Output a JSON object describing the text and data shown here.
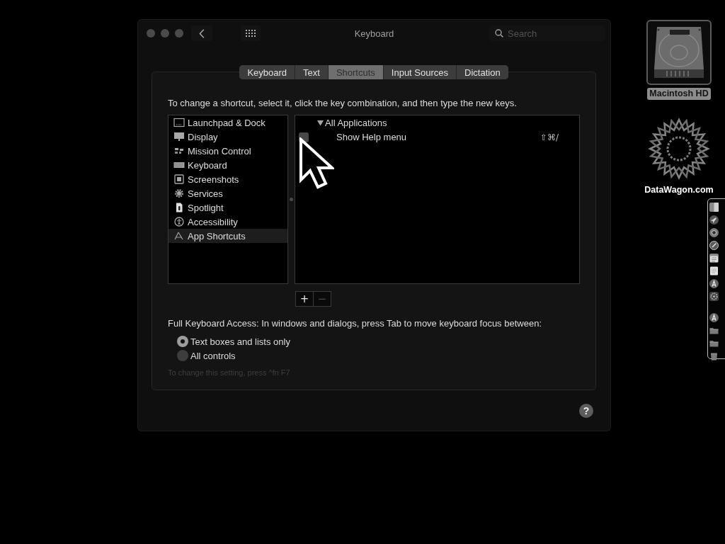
{
  "window": {
    "title": "Keyboard",
    "search": {
      "placeholder": "Search"
    }
  },
  "tabs": [
    {
      "label": "Keyboard",
      "selected": false
    },
    {
      "label": "Text",
      "selected": false
    },
    {
      "label": "Shortcuts",
      "selected": true
    },
    {
      "label": "Input Sources",
      "selected": false
    },
    {
      "label": "Dictation",
      "selected": false
    }
  ],
  "instructions": "To change a shortcut, select it, click the key combination, and then type the new keys.",
  "categories": [
    {
      "label": "Launchpad & Dock",
      "kind": "launchpad",
      "selected": false
    },
    {
      "label": "Display",
      "kind": "display",
      "selected": false
    },
    {
      "label": "Mission Control",
      "kind": "mission",
      "selected": false
    },
    {
      "label": "Keyboard",
      "kind": "keyboard",
      "selected": false
    },
    {
      "label": "Screenshots",
      "kind": "screenshots",
      "selected": false
    },
    {
      "label": "Services",
      "kind": "services",
      "selected": false
    },
    {
      "label": "Spotlight",
      "kind": "spotlight",
      "selected": false
    },
    {
      "label": "Accessibility",
      "kind": "accessibility",
      "selected": false
    },
    {
      "label": "App Shortcuts",
      "kind": "apps",
      "selected": true
    }
  ],
  "shortcuts": [
    {
      "label": "All Applications",
      "expanded": true,
      "children": [
        {
          "label": "Show Help menu",
          "checked": false,
          "keys": "⇧⌘/"
        }
      ]
    }
  ],
  "list_buttons": [
    {
      "label": "+",
      "disabled": false
    },
    {
      "label": "−",
      "disabled": true
    }
  ],
  "keyboard_access": {
    "label": "Full Keyboard Access: In windows and dialogs, press Tab to move keyboard focus between:",
    "options": [
      {
        "label": "Text boxes and lists only",
        "selected": true
      },
      {
        "label": "All controls",
        "selected": false
      }
    ],
    "hint": "To change this setting, press ^fn F7"
  },
  "help_button": "?",
  "desktop_icons": [
    {
      "label": "Macintosh HD",
      "kind": "drive",
      "selected": true
    },
    {
      "label": "DataWagon.com",
      "kind": "star",
      "selected": false
    }
  ],
  "dock": {
    "apps": [
      {
        "kind": "tile"
      },
      {
        "kind": "rocket"
      },
      {
        "kind": "ring"
      },
      {
        "kind": "compass"
      },
      {
        "kind": "calendar"
      },
      {
        "kind": "note"
      },
      {
        "kind": "pencils"
      },
      {
        "kind": "gear"
      }
    ],
    "others": [
      {
        "kind": "pencils"
      },
      {
        "kind": "folder"
      },
      {
        "kind": "folder"
      },
      {
        "kind": "trash"
      }
    ]
  }
}
